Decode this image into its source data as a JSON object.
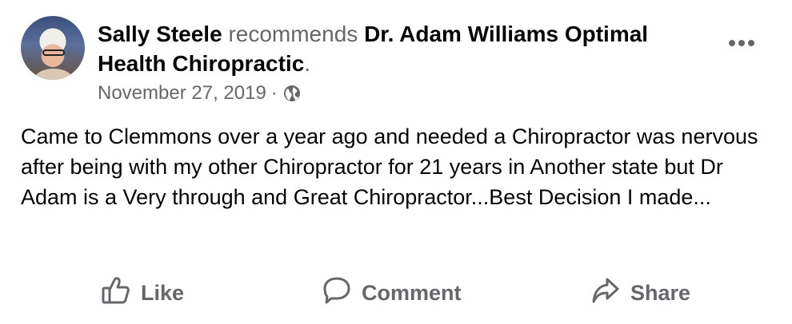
{
  "post": {
    "author": "Sally Steele",
    "verb": "recommends",
    "page": "Dr. Adam Williams Optimal Health Chiropractic",
    "period": ".",
    "date": "November 27, 2019",
    "separator": "·",
    "privacy_icon": "globe-icon",
    "body": "Came to Clemmons over a year ago and needed a Chiropractor was nervous after being with my other Chiropractor for 21 years in Another state but Dr Adam is a Very through and Great Chiropractor...Best Decision I made..."
  },
  "actions": {
    "like": "Like",
    "comment": "Comment",
    "share": "Share"
  },
  "icons": {
    "like": "thumbs-up-icon",
    "comment": "speech-bubble-icon",
    "share": "share-arrow-icon",
    "more": "ellipsis-icon"
  },
  "colors": {
    "primary_text": "#050505",
    "secondary_text": "#65676b",
    "background": "#ffffff"
  }
}
